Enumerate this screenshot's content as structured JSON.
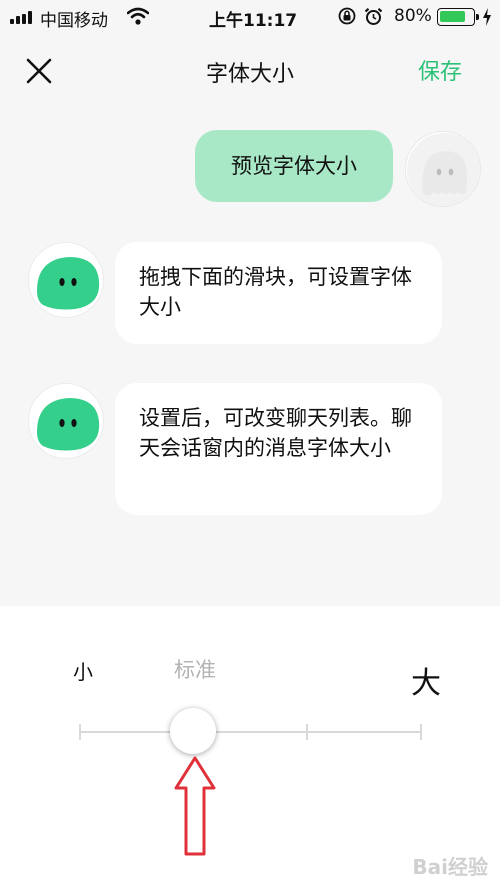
{
  "status_bar": {
    "carrier": "中国移动",
    "time": "上午11:17",
    "battery_percent": "80%",
    "battery_level": 0.8,
    "icons": [
      "signal-icon",
      "wifi-icon",
      "orientation-lock-icon",
      "alarm-icon",
      "battery-icon",
      "charging-icon"
    ]
  },
  "nav": {
    "close_icon": "close-icon",
    "title": "字体大小",
    "save_label": "保存"
  },
  "chat": {
    "my_message": "预览字体大小",
    "bot_messages": [
      "拖拽下面的滑块，可设置字体大小",
      "设置后，可改变聊天列表。聊天会话窗内的消息字体大小"
    ]
  },
  "font_size_slider": {
    "label_small": "小",
    "label_standard": "标准",
    "label_large": "大",
    "steps": 4,
    "selected_step": 1
  },
  "annotation": {
    "icon": "red-up-arrow-icon"
  },
  "watermark": "Bai经验",
  "colors": {
    "accent": "#2bc278",
    "my_bubble": "#a9e8c7",
    "bot_avatar": "#35cf8c",
    "background": "#f6f6f6",
    "arrow": "#e0313a"
  }
}
